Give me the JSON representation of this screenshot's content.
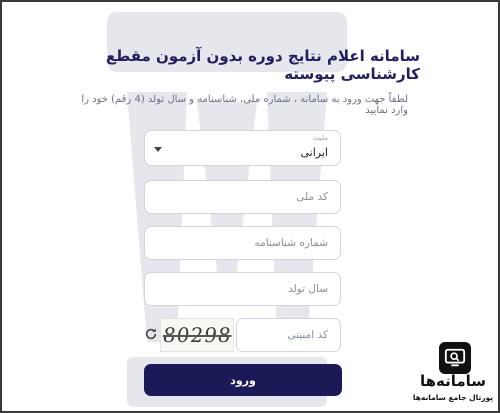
{
  "form": {
    "title": "سامانه اعلام نتایج دوره بدون آزمون مقطع کارشناسی پیوسته",
    "instructions": "لطفاً جهت ورود به سامانه ، شماره ملی، شناسنامه و سال تولد (4 رقم) خود را وارد نمایید",
    "nationality": {
      "label": "ملیت",
      "value": "ایرانی"
    },
    "national_code": {
      "placeholder": "کد ملی",
      "value": ""
    },
    "id_number": {
      "placeholder": "شماره شناسنامه",
      "value": ""
    },
    "birth_year": {
      "placeholder": "سال تولد",
      "value": ""
    },
    "captcha": {
      "placeholder": "کد امنیتی",
      "value": "",
      "image_text": "80298"
    },
    "submit_label": "ورود"
  },
  "watermark_logo": {
    "name": "university-emblem-icon"
  },
  "brand": {
    "name": "سامانه‌ها",
    "tagline": "پورتال جامع سامانه‌ها",
    "icon": "monitor-search-icon"
  },
  "colors": {
    "title": "#22205e",
    "button": "#1b1a57",
    "border": "#d3d5dc"
  }
}
